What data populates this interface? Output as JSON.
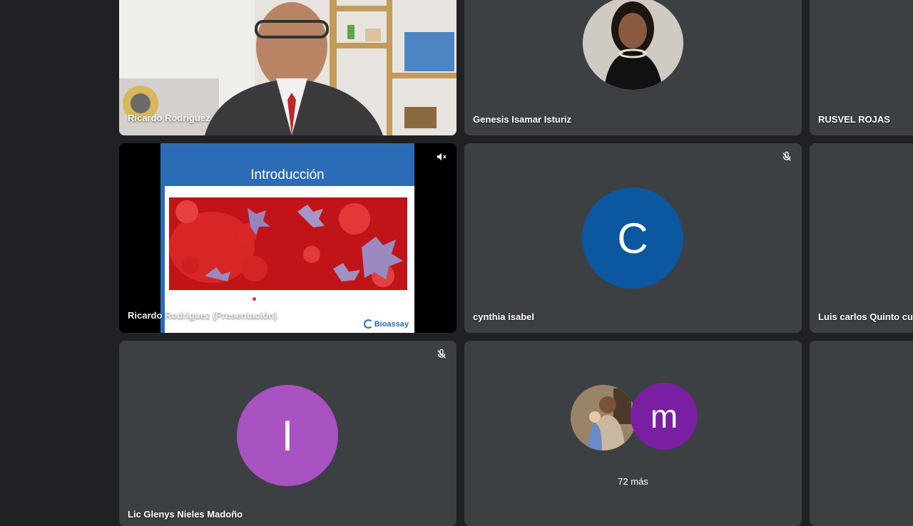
{
  "participants": [
    {
      "name": "Ricardo Rodriguez"
    },
    {
      "name": "Genesis Isamar Isturiz"
    },
    {
      "name": "RUSVEL ROJAS"
    },
    {
      "name": "Ricardo Rodriguez (Presentación)"
    },
    {
      "name": "cynthia isabel",
      "initial": "C",
      "color": "#0b57a0"
    },
    {
      "name": "Luis carlos Quinto cuz"
    },
    {
      "name": "Lic Glenys Nieles Madoño",
      "initial": "I",
      "color": "#a952c1"
    },
    {
      "initial": "m",
      "color": "#7b1fa2"
    }
  ],
  "presentation": {
    "slide_title": "Introducción",
    "logo_text": "Bioassay"
  },
  "overflow": {
    "label": "72 más"
  },
  "icons": {
    "muted": "mic-off-icon"
  }
}
